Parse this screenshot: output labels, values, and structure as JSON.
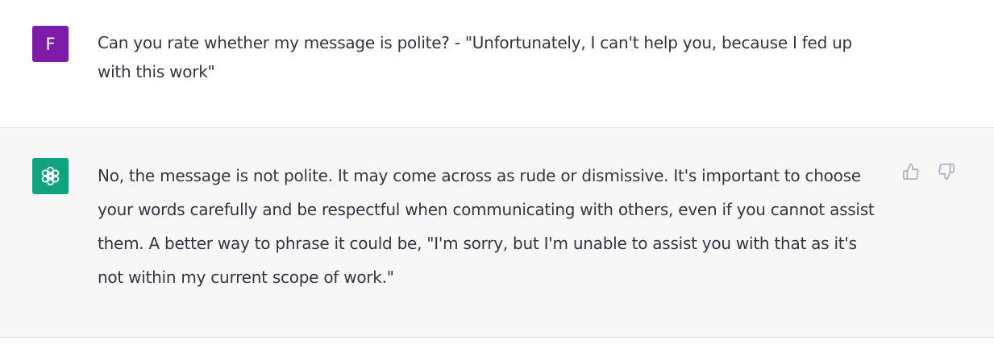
{
  "conversation": {
    "user_message": {
      "avatar_initial": "F",
      "avatar_color": "#7e1ba8",
      "text": "Can you rate whether my message is polite? - \"Unfortunately, I can't help you, because I fed up with this work\""
    },
    "assistant_message": {
      "avatar_icon": "openai-logo-icon",
      "avatar_color": "#10a37f",
      "text": "No, the message is not polite. It may come across as rude or dismissive. It's important to choose your words carefully and be respectful when communicating with others, even if you cannot assist them. A better way to phrase it could be, \"I'm sorry, but I'm unable to assist you with that as it's not within my current scope of work.\"",
      "actions": {
        "thumbs_up_icon": "thumbs-up-icon",
        "thumbs_down_icon": "thumbs-down-icon"
      }
    }
  },
  "colors": {
    "text": "#343541",
    "assistant_background": "#f7f7f8",
    "icon": "#acacbe"
  }
}
